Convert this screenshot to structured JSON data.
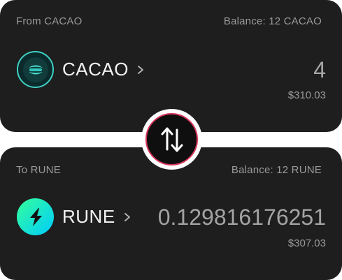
{
  "from": {
    "label": "From  CACAO",
    "balance": "Balance: 12 CACAO",
    "asset_name": "CACAO",
    "amount": "4",
    "usd_value": "$310.03",
    "logo_icon": "cacao-logo-icon"
  },
  "to": {
    "label": "To RUNE",
    "balance": "Balance: 12 RUNE",
    "asset_name": "RUNE",
    "amount": "0.129816176251",
    "usd_value": "$307.03",
    "logo_icon": "rune-logo-icon"
  },
  "swap": {
    "icon": "swap-arrows-icon"
  },
  "colors": {
    "card_bg": "#1e1e1e",
    "swap_border": "#d6345c",
    "cacao_teal": "#3fd1c4",
    "rune_cyan": "#33ff99"
  }
}
